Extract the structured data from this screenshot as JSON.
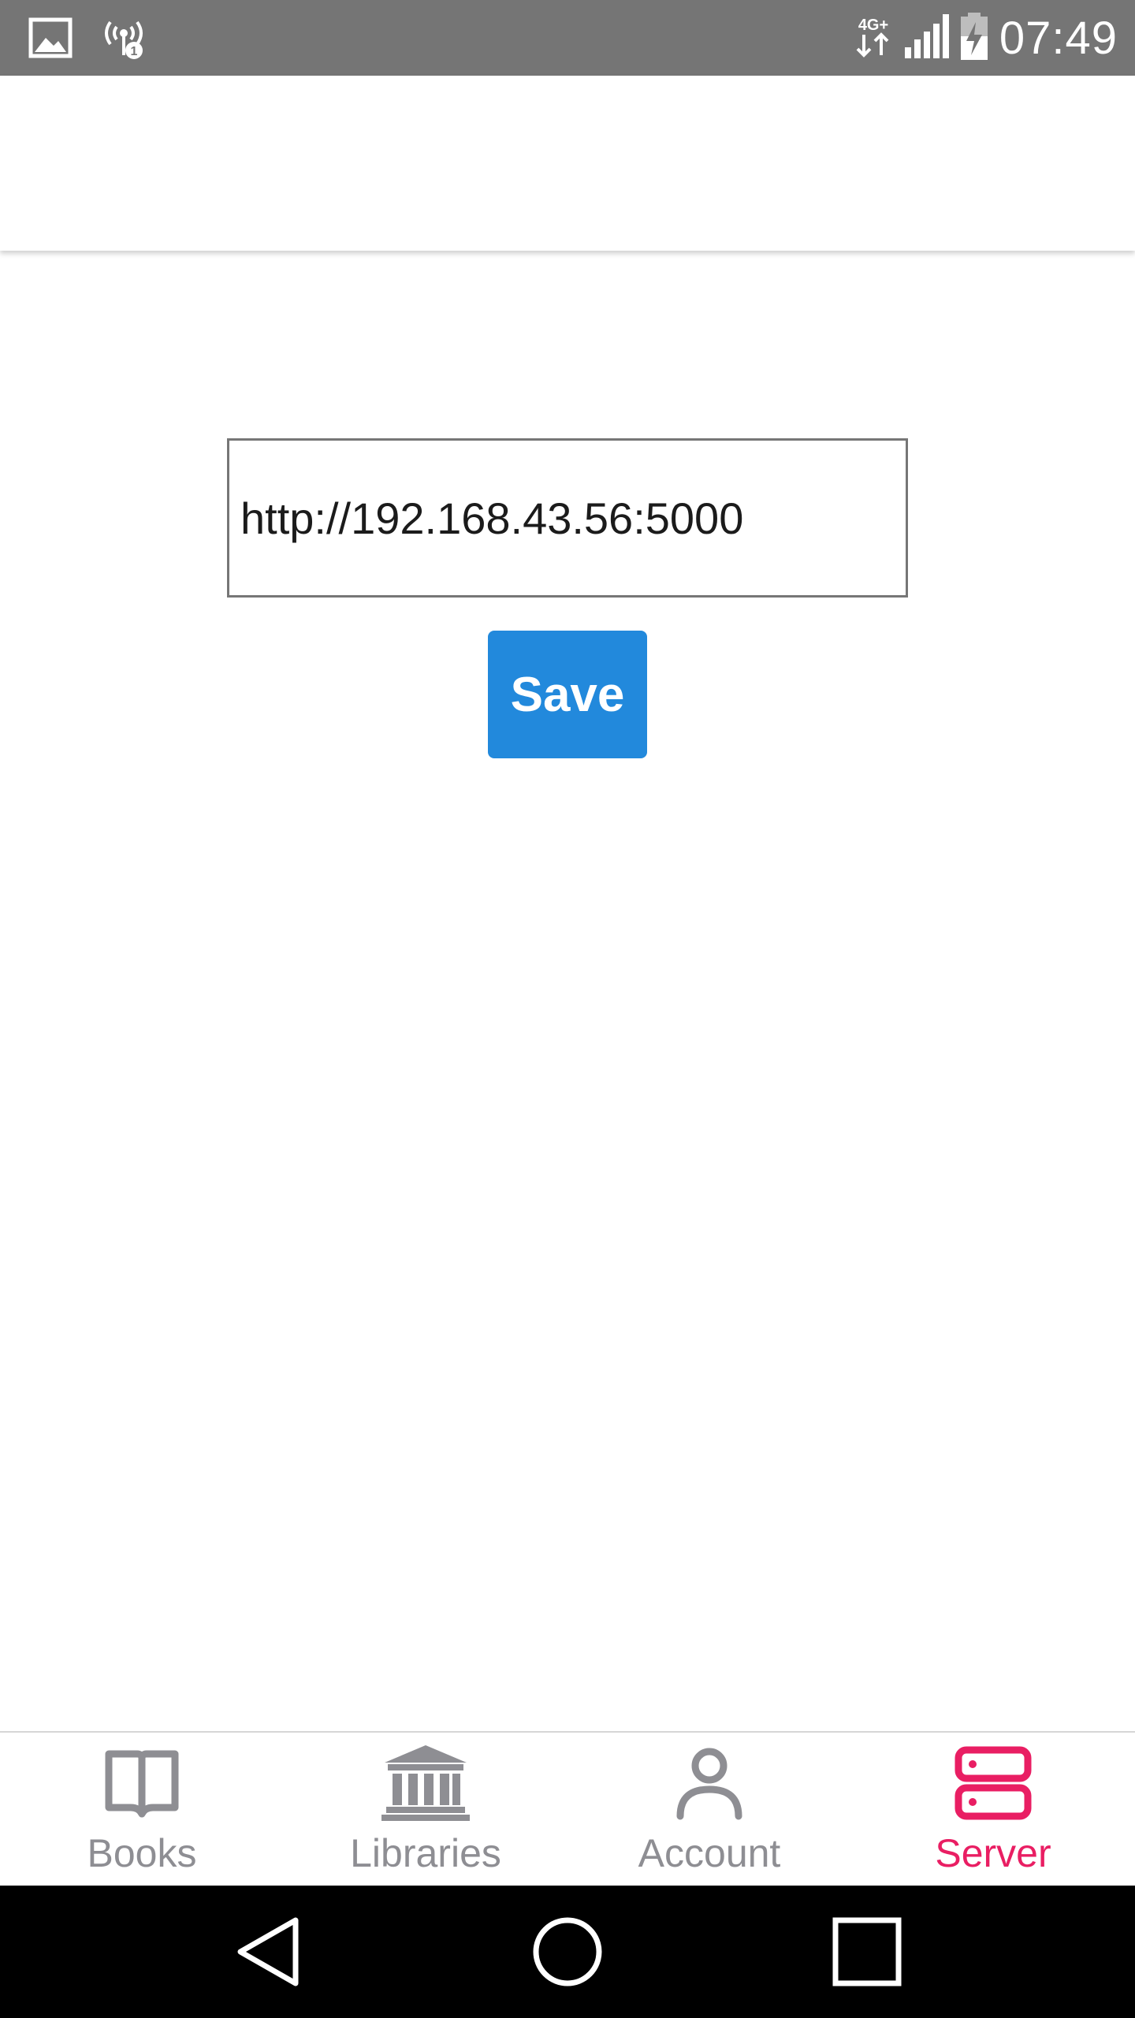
{
  "status_bar": {
    "time": "07:49",
    "left_icons": [
      "image-icon",
      "hotspot-icon"
    ],
    "right_icons": [
      "network-4g-plus-icon",
      "signal-icon",
      "battery-charging-icon"
    ],
    "network_label": "4G+",
    "bg_color": "#757575"
  },
  "server_form": {
    "url_value": "http://192.168.43.56:5000",
    "save_label": "Save",
    "save_color": "#2289dc"
  },
  "tab_bar": {
    "active_color": "#e91e63",
    "inactive_color": "#8e8e93",
    "tabs": [
      {
        "label": "Books",
        "icon": "book-icon",
        "active": false
      },
      {
        "label": "Libraries",
        "icon": "library-icon",
        "active": false
      },
      {
        "label": "Account",
        "icon": "account-icon",
        "active": false
      },
      {
        "label": "Server",
        "icon": "server-icon",
        "active": true
      }
    ]
  },
  "nav_bar": {
    "buttons": [
      "back-icon",
      "home-icon",
      "recents-icon"
    ]
  }
}
